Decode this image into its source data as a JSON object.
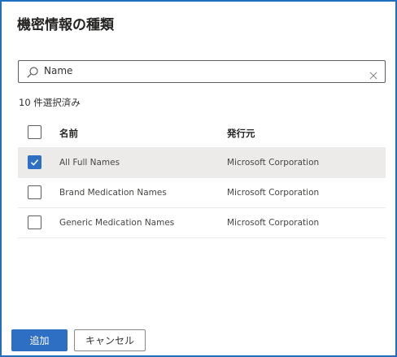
{
  "dialog": {
    "title": "機密情報の種類",
    "search": {
      "value": "Name"
    },
    "selected_count": "10 件選択済み",
    "table": {
      "columns": {
        "name": "名前",
        "publisher": "発行元"
      },
      "rows": [
        {
          "name": "All Full Names",
          "publisher": "Microsoft Corporation",
          "checked": true
        },
        {
          "name": "Brand Medication Names",
          "publisher": "Microsoft Corporation",
          "checked": false
        },
        {
          "name": "Generic Medication Names",
          "publisher": "Microsoft Corporation",
          "checked": false
        }
      ]
    },
    "buttons": {
      "add": "追加",
      "cancel": "キャンセル"
    }
  },
  "colors": {
    "accent": "#2e6fc4",
    "frame_border": "#1f6fbf",
    "selected_row": "#edebe9"
  },
  "icons": {
    "search": "search-icon",
    "clear": "close-icon",
    "check": "checkmark-icon"
  }
}
